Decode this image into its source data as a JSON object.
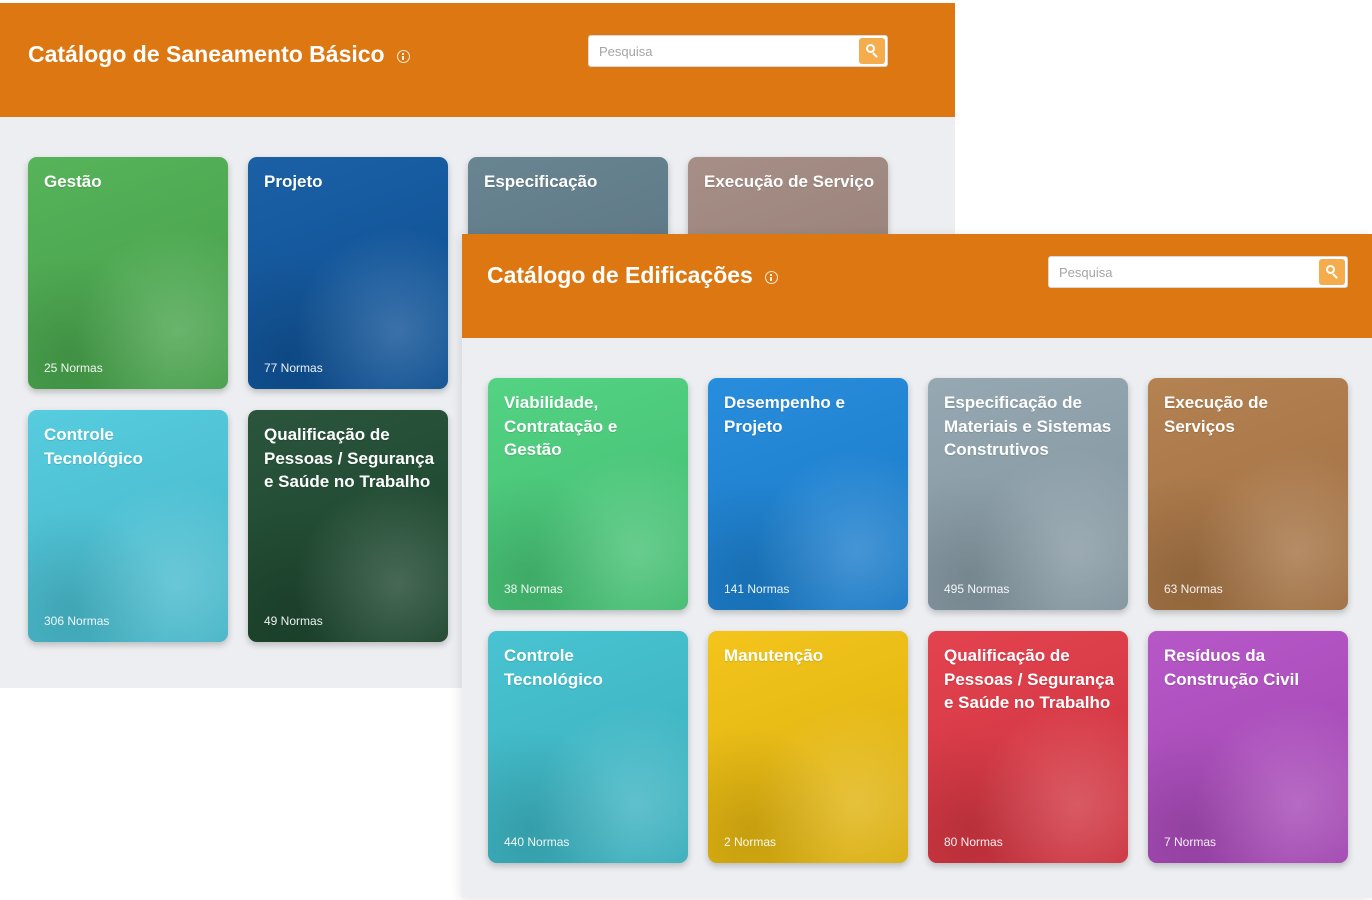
{
  "panels": [
    {
      "title": "Catálogo de Saneamento Básico",
      "search_placeholder": "Pesquisa",
      "cards": [
        {
          "label": "Gestão",
          "count": "25 Normas",
          "color": "#4caf50"
        },
        {
          "label": "Projeto",
          "count": "77 Normas",
          "color": "#0d56a0"
        },
        {
          "label": "Especificação",
          "count": "",
          "color": "#607d8b"
        },
        {
          "label": "Execução de Serviço",
          "count": "",
          "color": "#a1887f"
        },
        {
          "label": "Controle Tecnológico",
          "count": "306 Normas",
          "color": "#4cc9dd"
        },
        {
          "label": "Qualificação de Pessoas / Segurança e Saúde no Trabalho",
          "count": "49 Normas",
          "color": "#1d4a30"
        }
      ]
    },
    {
      "title": "Catálogo de Edificações",
      "search_placeholder": "Pesquisa",
      "cards": [
        {
          "label": "Viabilidade, Contratação e Gestão",
          "count": "38 Normas",
          "color": "#49d07c"
        },
        {
          "label": "Desempenho e Projeto",
          "count": "141 Normas",
          "color": "#1b86db"
        },
        {
          "label": "Especificação de Materiais e Sistemas Construtivos",
          "count": "495 Normas",
          "color": "#8fa3ae"
        },
        {
          "label": "Execução de Serviços",
          "count": "63 Normas",
          "color": "#b07a47"
        },
        {
          "label": "Controle Tecnológico",
          "count": "440 Normas",
          "color": "#3ec0cf"
        },
        {
          "label": "Manutenção",
          "count": "2 Normas",
          "color": "#f2c10e"
        },
        {
          "label": "Qualificação de Pessoas / Segurança e Saúde no Trabalho",
          "count": "80 Normas",
          "color": "#e13744"
        },
        {
          "label": "Resíduos da Construção Civil",
          "count": "7 Normas",
          "color": "#b24dc4"
        }
      ]
    }
  ]
}
